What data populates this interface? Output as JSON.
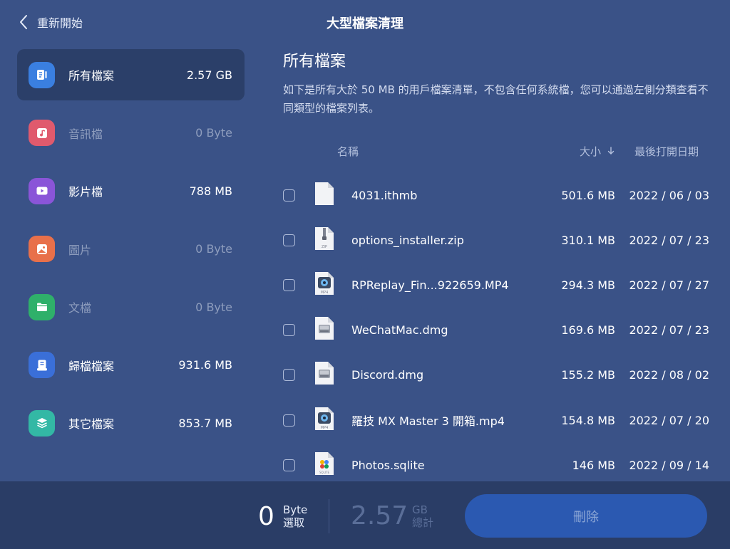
{
  "header": {
    "back_label": "重新開始",
    "title": "大型檔案清理"
  },
  "sidebar": {
    "items": [
      {
        "label": "所有檔案",
        "size": "2.57 GB",
        "color": "#3a7fe0"
      },
      {
        "label": "音訊檔",
        "size": "0 Byte",
        "color": "#e05a6d"
      },
      {
        "label": "影片檔",
        "size": "788 MB",
        "color": "#8a55d8"
      },
      {
        "label": "圖片",
        "size": "0 Byte",
        "color": "#e8704a"
      },
      {
        "label": "文檔",
        "size": "0 Byte",
        "color": "#2fb06a"
      },
      {
        "label": "歸檔檔案",
        "size": "931.6 MB",
        "color": "#3a6fd8"
      },
      {
        "label": "其它檔案",
        "size": "853.7 MB",
        "color": "#33b8a5"
      }
    ]
  },
  "main": {
    "title": "所有檔案",
    "description": "如下是所有大於 50 MB 的用戶檔案清單，不包含任何系統檔，您可以通過左側分類查看不同類型的檔案列表。",
    "columns": {
      "name": "名稱",
      "size": "大小",
      "date": "最後打開日期"
    },
    "files": [
      {
        "name": "4031.ithmb",
        "size": "501.6 MB",
        "date": "2022 / 06 / 03",
        "icon": "document-icon"
      },
      {
        "name": "options_installer.zip",
        "size": "310.1 MB",
        "date": "2022 / 07 / 23",
        "icon": "zip-file-icon",
        "icon_text": "ZIP"
      },
      {
        "name": "RPReplay_Fin...922659.MP4",
        "size": "294.3 MB",
        "date": "2022 / 07 / 27",
        "icon": "mp4-file-icon",
        "icon_text": "MP4"
      },
      {
        "name": "WeChatMac.dmg",
        "size": "169.6 MB",
        "date": "2022 / 07 / 23",
        "icon": "disk-image-icon"
      },
      {
        "name": "Discord.dmg",
        "size": "155.2 MB",
        "date": "2022 / 08 / 02",
        "icon": "disk-image-icon"
      },
      {
        "name": "羅技 MX Master 3 開箱.mp4",
        "size": "154.8 MB",
        "date": "2022 / 07 / 20",
        "icon": "mp4-file-icon",
        "icon_text": "MP4"
      },
      {
        "name": "Photos.sqlite",
        "size": "146 MB",
        "date": "2022 / 09 / 14",
        "icon": "sqlite-file-icon",
        "icon_text": "SQLITE"
      }
    ]
  },
  "footer": {
    "selected_value": "0",
    "selected_unit": "Byte",
    "selected_label": "選取",
    "total_value": "2.57",
    "total_unit": "GB",
    "total_label": "總計",
    "delete_label": "刪除"
  }
}
